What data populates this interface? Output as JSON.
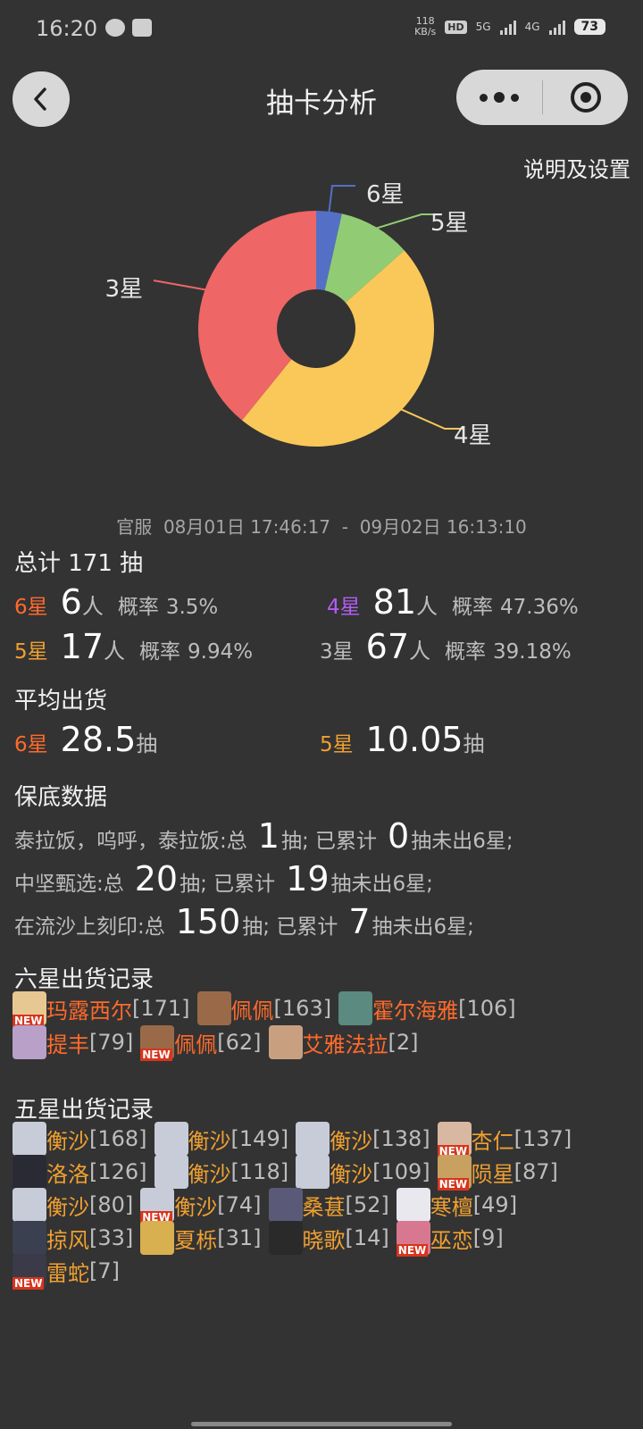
{
  "status_bar": {
    "time": "16:20",
    "net_speed_value": "118",
    "net_speed_unit": "KB/s",
    "network_1": "5G",
    "network_2": "4G",
    "battery": "73"
  },
  "nav": {
    "title": "抽卡分析"
  },
  "settings_link": "说明及设置",
  "chart_data": {
    "type": "pie",
    "donut": true,
    "slices": [
      {
        "label": "6星",
        "value": 6,
        "color": "#5470c6"
      },
      {
        "label": "5星",
        "value": 17,
        "color": "#91cc75"
      },
      {
        "label": "4星",
        "value": 81,
        "color": "#fac858"
      },
      {
        "label": "3星",
        "value": 67,
        "color": "#ee6666"
      }
    ]
  },
  "date_range": {
    "server": "官服",
    "start": "08月01日 17:46:17",
    "sep": "-",
    "end": "09月02日 16:13:10"
  },
  "total": {
    "title": "总计 171 抽"
  },
  "stats": [
    {
      "star": "6星",
      "count": "6",
      "unit": "人",
      "rate_label": "概率",
      "rate": "3.5%",
      "color": "#ff6a2b"
    },
    {
      "star": "4星",
      "count": "81",
      "unit": "人",
      "rate_label": "概率",
      "rate": "47.36%",
      "color": "#b45cf5"
    },
    {
      "star": "5星",
      "count": "17",
      "unit": "人",
      "rate_label": "概率",
      "rate": "9.94%",
      "color": "#f0a030"
    },
    {
      "star": "3星",
      "count": "67",
      "unit": "人",
      "rate_label": "概率",
      "rate": "39.18%",
      "color": "#bdbdbd"
    }
  ],
  "average": {
    "title": "平均出货",
    "six": {
      "star": "6星",
      "value": "28.5",
      "unit": "抽"
    },
    "five": {
      "star": "5星",
      "value": "10.05",
      "unit": "抽"
    }
  },
  "pity": {
    "title": "保底数据",
    "rows": [
      {
        "pool": "泰拉饭，呜呼，泰拉饭:总",
        "total": "1",
        "mid": "抽; 已累计",
        "acc": "0",
        "tail": "抽未出6星;"
      },
      {
        "pool": "中坚甄选:总",
        "total": "20",
        "mid": "抽; 已累计",
        "acc": "19",
        "tail": "抽未出6星;"
      },
      {
        "pool": "在流沙上刻印:总",
        "total": "150",
        "mid": "抽; 已累计",
        "acc": "7",
        "tail": "抽未出6星;"
      }
    ]
  },
  "six_star_records": {
    "title": "六星出货记录",
    "new_label": "NEW",
    "lines": [
      [
        {
          "name": "玛露西尔",
          "num": "[171]",
          "new": true,
          "avatar_color": "#e8c892"
        },
        {
          "name": "佩佩",
          "num": "[163]",
          "new": false,
          "avatar_color": "#9a6a48"
        },
        {
          "name": "霍尔海雅",
          "num": "[106]",
          "new": false,
          "avatar_color": "#5a8a80"
        }
      ],
      [
        {
          "name": "提丰",
          "num": "[79]",
          "new": false,
          "avatar_color": "#b8a0c8"
        },
        {
          "name": "佩佩",
          "num": "[62]",
          "new": true,
          "avatar_color": "#9a6a48"
        },
        {
          "name": "艾雅法拉",
          "num": "[2]",
          "new": false,
          "avatar_color": "#c8a080"
        }
      ]
    ]
  },
  "five_star_records": {
    "title": "五星出货记录",
    "lines": [
      [
        {
          "name": "衡沙",
          "num": "[168]",
          "new": false,
          "avatar_color": "#c8ccd8"
        },
        {
          "name": "衡沙",
          "num": "[149]",
          "new": false,
          "avatar_color": "#c8ccd8"
        },
        {
          "name": "衡沙",
          "num": "[138]",
          "new": false,
          "avatar_color": "#c8ccd8"
        },
        {
          "name": "杏仁",
          "num": "[137]",
          "new": true,
          "avatar_color": "#d8b8a0"
        }
      ],
      [
        {
          "name": "洛洛",
          "num": "[126]",
          "new": false,
          "avatar_color": "#2a2a35"
        },
        {
          "name": "衡沙",
          "num": "[118]",
          "new": false,
          "avatar_color": "#c8ccd8"
        },
        {
          "name": "衡沙",
          "num": "[109]",
          "new": false,
          "avatar_color": "#c8ccd8"
        },
        {
          "name": "陨星",
          "num": "[87]",
          "new": true,
          "avatar_color": "#c8a060"
        }
      ],
      [
        {
          "name": "衡沙",
          "num": "[80]",
          "new": false,
          "avatar_color": "#c8ccd8"
        },
        {
          "name": "衡沙",
          "num": "[74]",
          "new": true,
          "avatar_color": "#c8ccd8"
        },
        {
          "name": "桑葚",
          "num": "[52]",
          "new": false,
          "avatar_color": "#5a5a78"
        },
        {
          "name": "寒檀",
          "num": "[49]",
          "new": false,
          "avatar_color": "#e8e8ee"
        }
      ],
      [
        {
          "name": "掠风",
          "num": "[33]",
          "new": false,
          "avatar_color": "#3a4050"
        },
        {
          "name": "夏栎",
          "num": "[31]",
          "new": false,
          "avatar_color": "#d8b050"
        },
        {
          "name": "晓歌",
          "num": "[14]",
          "new": false,
          "avatar_color": "#2a2a2a"
        },
        {
          "name": "巫恋",
          "num": "[9]",
          "new": true,
          "avatar_color": "#d87890"
        }
      ],
      [
        {
          "name": "雷蛇",
          "num": "[7]",
          "new": true,
          "avatar_color": "#3a3a48"
        }
      ]
    ]
  }
}
